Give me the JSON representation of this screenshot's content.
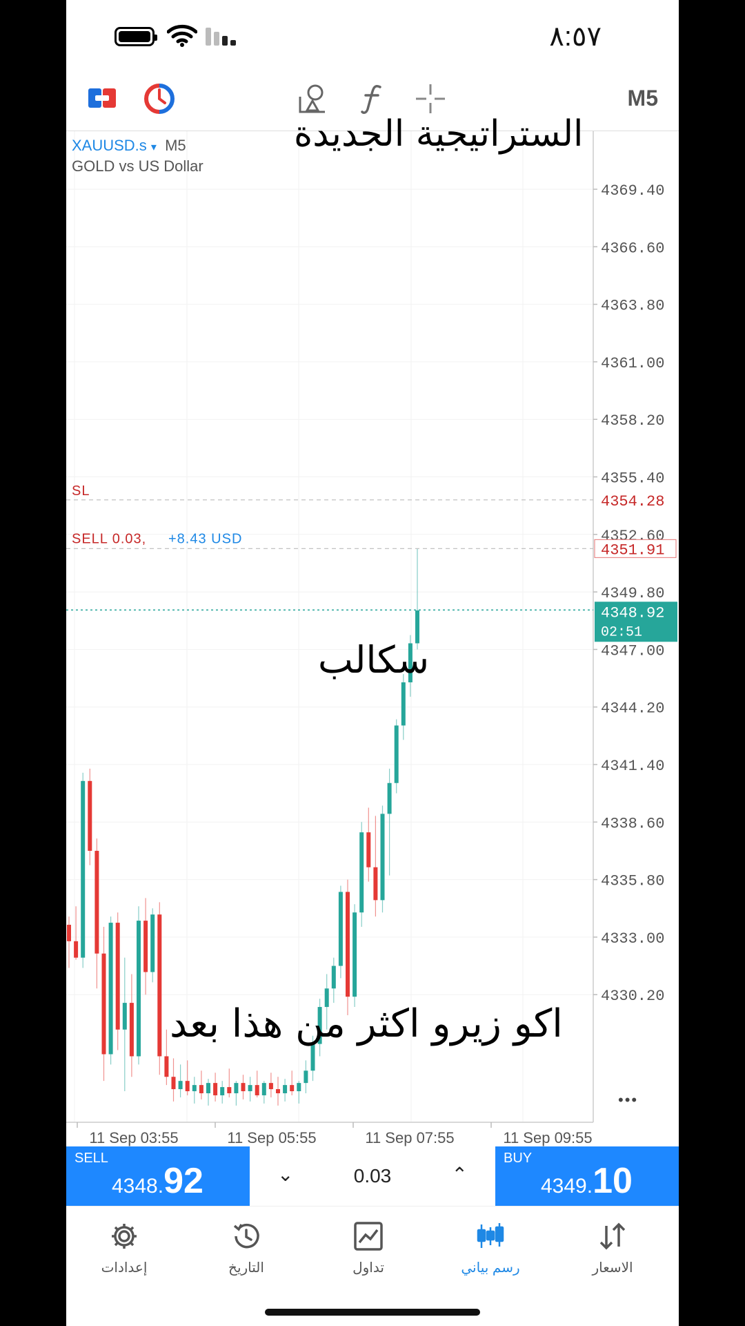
{
  "status_bar": {
    "time": "٨:٥٧"
  },
  "toolbar": {
    "timeframe": "M5",
    "icons": [
      "order-icon",
      "one-click-icon",
      "objects-icon",
      "indicators-icon",
      "crosshair-icon"
    ]
  },
  "chart_header": {
    "symbol": "XAUUSD.s",
    "dropdown_glyph": "▾",
    "timeframe": "M5",
    "description": "GOLD vs US Dollar"
  },
  "overlays": {
    "title": "الستراتيجية الجديدة",
    "mid": "سكالب",
    "bottom": "اكو زيرو اكثر من هذا بعد"
  },
  "more_glyph": "•••",
  "chart_data": {
    "type": "candlestick",
    "y_ticks": [
      "4369.40",
      "4366.60",
      "4363.80",
      "4361.00",
      "4358.20",
      "4355.40",
      "4352.60",
      "4349.80",
      "4347.00",
      "4344.20",
      "4341.40",
      "4338.60",
      "4335.80",
      "4333.00",
      "4330.20"
    ],
    "ylim": [
      4327.0,
      4371.0
    ],
    "x_ticks": [
      "11 Sep 03:55",
      "11 Sep 05:55",
      "11 Sep 07:55",
      "11 Sep 09:55"
    ],
    "sl": {
      "label": "SL",
      "price": "4354.28"
    },
    "order": {
      "label": "SELL 0.03,",
      "profit": "+8.43 USD",
      "price": "4351.91"
    },
    "current": {
      "price": "4348.92",
      "countdown": "02:51"
    },
    "candles": [
      [
        4333.6,
        4334.0,
        4331.5,
        4332.8
      ],
      [
        4332.8,
        4334.5,
        4331.9,
        4332.0
      ],
      [
        4332.0,
        4341.0,
        4331.5,
        4340.6
      ],
      [
        4340.6,
        4341.2,
        4336.5,
        4337.2
      ],
      [
        4337.2,
        4337.8,
        4330.5,
        4332.2
      ],
      [
        4332.2,
        4333.5,
        4326.0,
        4327.3
      ],
      [
        4327.3,
        4334.0,
        4326.8,
        4333.7
      ],
      [
        4333.7,
        4334.2,
        4327.5,
        4328.5
      ],
      [
        4328.5,
        4332.0,
        4325.5,
        4329.8
      ],
      [
        4329.8,
        4331.2,
        4326.2,
        4327.2
      ],
      [
        4327.2,
        4334.5,
        4326.8,
        4333.8
      ],
      [
        4333.8,
        4334.9,
        4330.2,
        4331.3
      ],
      [
        4331.3,
        4334.4,
        4330.8,
        4334.1
      ],
      [
        4334.1,
        4334.7,
        4326.3,
        4327.2
      ],
      [
        4327.2,
        4328.5,
        4325.8,
        4326.2
      ],
      [
        4326.2,
        4327.1,
        4325.0,
        4325.6
      ],
      [
        4325.6,
        4326.8,
        4325.2,
        4326.0
      ],
      [
        4326.0,
        4327.0,
        4325.3,
        4325.5
      ],
      [
        4325.5,
        4326.2,
        4324.9,
        4325.8
      ],
      [
        4325.8,
        4326.5,
        4325.1,
        4325.4
      ],
      [
        4325.4,
        4326.1,
        4324.8,
        4325.9
      ],
      [
        4325.9,
        4326.4,
        4325.0,
        4325.3
      ],
      [
        4325.3,
        4326.0,
        4324.9,
        4325.7
      ],
      [
        4325.7,
        4326.6,
        4325.2,
        4325.4
      ],
      [
        4325.4,
        4326.0,
        4324.8,
        4325.9
      ],
      [
        4325.9,
        4326.3,
        4325.1,
        4325.5
      ],
      [
        4325.5,
        4326.2,
        4325.0,
        4325.8
      ],
      [
        4325.8,
        4326.5,
        4325.2,
        4325.3
      ],
      [
        4325.3,
        4326.0,
        4324.9,
        4325.9
      ],
      [
        4325.9,
        4326.4,
        4325.2,
        4325.6
      ],
      [
        4325.6,
        4326.2,
        4324.8,
        4325.4
      ],
      [
        4325.4,
        4326.1,
        4325.0,
        4325.8
      ],
      [
        4325.8,
        4326.5,
        4325.3,
        4325.5
      ],
      [
        4325.5,
        4326.0,
        4324.9,
        4325.9
      ],
      [
        4325.9,
        4327.0,
        4325.4,
        4326.5
      ],
      [
        4326.5,
        4328.2,
        4326.0,
        4327.8
      ],
      [
        4327.8,
        4330.0,
        4327.2,
        4329.6
      ],
      [
        4329.6,
        4331.2,
        4328.5,
        4330.5
      ],
      [
        4330.5,
        4332.0,
        4329.8,
        4331.6
      ],
      [
        4331.6,
        4335.5,
        4331.0,
        4335.2
      ],
      [
        4335.2,
        4335.8,
        4329.2,
        4330.1
      ],
      [
        4330.1,
        4334.6,
        4329.6,
        4334.2
      ],
      [
        4334.2,
        4338.6,
        4333.5,
        4338.1
      ],
      [
        4338.1,
        4339.3,
        4335.7,
        4336.4
      ],
      [
        4336.4,
        4338.9,
        4334.0,
        4334.8
      ],
      [
        4334.8,
        4339.4,
        4334.2,
        4339.0
      ],
      [
        4339.0,
        4341.2,
        4336.0,
        4340.5
      ],
      [
        4340.5,
        4343.6,
        4340.0,
        4343.3
      ],
      [
        4343.3,
        4345.8,
        4342.6,
        4345.4
      ],
      [
        4345.4,
        4347.7,
        4344.7,
        4347.3
      ],
      [
        4347.3,
        4351.9,
        4347.0,
        4348.9
      ]
    ]
  },
  "trade_bar": {
    "sell_label": "SELL",
    "sell_price_small": "4348.",
    "sell_price_big": "92",
    "buy_label": "BUY",
    "buy_price_small": "4349.",
    "buy_price_big": "10",
    "lot": "0.03",
    "down_glyph": "⌄",
    "up_glyph": "⌃"
  },
  "nav": [
    {
      "label": "إعدادات",
      "icon": "gear-icon"
    },
    {
      "label": "التاريخ",
      "icon": "history-icon"
    },
    {
      "label": "تداول",
      "icon": "trade-icon"
    },
    {
      "label": "رسم بياني",
      "icon": "chart-icon",
      "active": true
    },
    {
      "label": "الاسعار",
      "icon": "quotes-icon"
    }
  ],
  "colors": {
    "bull": "#26a69a",
    "bear": "#e53935",
    "accent": "#1e88ff",
    "sl": "#c62828"
  }
}
